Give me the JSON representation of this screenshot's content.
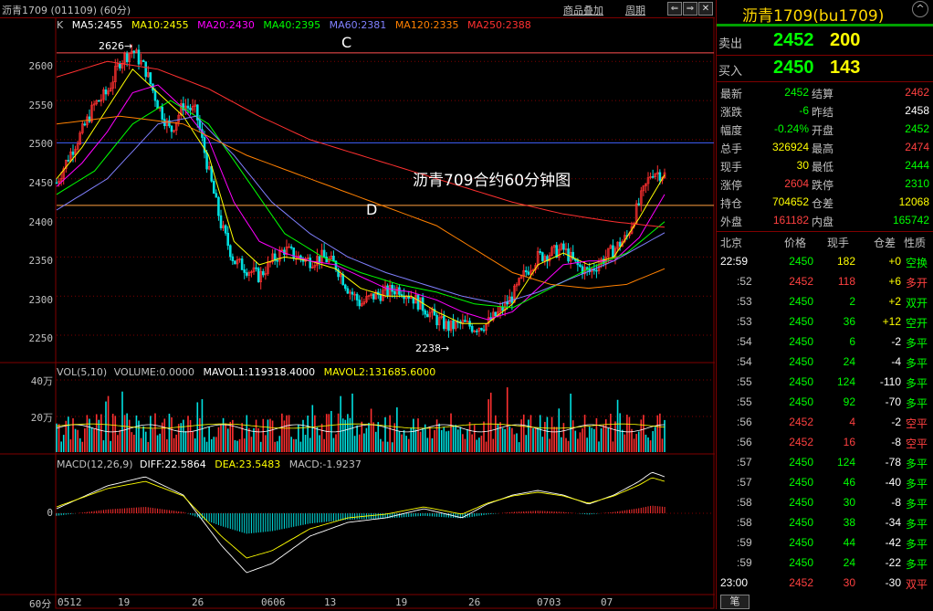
{
  "window_title": "沥青1709 (011109) (60分)",
  "toolbar": {
    "link1": "商品叠加",
    "link2": "周期",
    "btn_left": "⇐",
    "btn_right": "⇒",
    "btn_max": "□",
    "btn_close": "✕"
  },
  "chart_data": [
    {
      "type": "candlestick",
      "panel": "main",
      "prefix": "K",
      "title": "沥青709合约60分钟图",
      "ma_legend": [
        {
          "label": "MA5:2455",
          "color": "#ffffff"
        },
        {
          "label": "MA10:2455",
          "color": "#ffff00"
        },
        {
          "label": "MA20:2430",
          "color": "#ff00ff"
        },
        {
          "label": "MA40:2395",
          "color": "#00ff00"
        },
        {
          "label": "MA60:2381",
          "color": "#8080ff"
        },
        {
          "label": "MA120:2335",
          "color": "#ff8000"
        },
        {
          "label": "MA250:2388",
          "color": "#ff3030"
        }
      ],
      "y_ticks": [
        "2600",
        "2550",
        "2500",
        "2450",
        "2400",
        "2350",
        "2300",
        "2250"
      ],
      "ylim": [
        2215,
        2640
      ],
      "annotations": {
        "high": "2626",
        "low": "2238",
        "label_c": "C",
        "label_d": "D",
        "level_c": 2611,
        "level_blue": 2496,
        "level_d": 2416
      },
      "x_labels": [
        "0512",
        "19",
        "26",
        "0606",
        "13",
        "19",
        "26",
        "0703",
        "07"
      ],
      "close_path": [
        [
          0,
          2445
        ],
        [
          2,
          2480
        ],
        [
          4,
          2510
        ],
        [
          6,
          2545
        ],
        [
          8,
          2560
        ],
        [
          10,
          2600
        ],
        [
          12,
          2615
        ],
        [
          14,
          2590
        ],
        [
          16,
          2545
        ],
        [
          18,
          2510
        ],
        [
          20,
          2545
        ],
        [
          22,
          2535
        ],
        [
          24,
          2460
        ],
        [
          26,
          2390
        ],
        [
          28,
          2345
        ],
        [
          30,
          2335
        ],
        [
          32,
          2325
        ],
        [
          34,
          2345
        ],
        [
          36,
          2360
        ],
        [
          38,
          2350
        ],
        [
          40,
          2345
        ],
        [
          42,
          2350
        ],
        [
          44,
          2340
        ],
        [
          46,
          2310
        ],
        [
          48,
          2290
        ],
        [
          50,
          2300
        ],
        [
          52,
          2305
        ],
        [
          54,
          2310
        ],
        [
          56,
          2300
        ],
        [
          58,
          2285
        ],
        [
          60,
          2270
        ],
        [
          62,
          2260
        ],
        [
          64,
          2265
        ],
        [
          66,
          2260
        ],
        [
          68,
          2265
        ],
        [
          70,
          2280
        ],
        [
          72,
          2300
        ],
        [
          74,
          2330
        ],
        [
          76,
          2350
        ],
        [
          78,
          2355
        ],
        [
          80,
          2360
        ],
        [
          82,
          2340
        ],
        [
          84,
          2330
        ],
        [
          86,
          2345
        ],
        [
          88,
          2360
        ],
        [
          90,
          2375
        ],
        [
          92,
          2420
        ],
        [
          94,
          2460
        ],
        [
          96,
          2455
        ]
      ],
      "ma_paths": [
        {
          "name": "MA10",
          "color": "#ffff00",
          "points": [
            [
              0,
              2450
            ],
            [
              4,
              2490
            ],
            [
              8,
              2540
            ],
            [
              12,
              2590
            ],
            [
              16,
              2560
            ],
            [
              20,
              2530
            ],
            [
              24,
              2480
            ],
            [
              28,
              2370
            ],
            [
              32,
              2340
            ],
            [
              36,
              2350
            ],
            [
              40,
              2345
            ],
            [
              44,
              2335
            ],
            [
              48,
              2310
            ],
            [
              52,
              2300
            ],
            [
              56,
              2300
            ],
            [
              60,
              2280
            ],
            [
              64,
              2265
            ],
            [
              68,
              2265
            ],
            [
              72,
              2290
            ],
            [
              76,
              2340
            ],
            [
              80,
              2355
            ],
            [
              84,
              2340
            ],
            [
              88,
              2350
            ],
            [
              92,
              2400
            ],
            [
              96,
              2455
            ]
          ]
        },
        {
          "name": "MA20",
          "color": "#ff00ff",
          "points": [
            [
              0,
              2440
            ],
            [
              4,
              2470
            ],
            [
              8,
              2510
            ],
            [
              12,
              2560
            ],
            [
              16,
              2570
            ],
            [
              20,
              2540
            ],
            [
              24,
              2500
            ],
            [
              28,
              2420
            ],
            [
              32,
              2370
            ],
            [
              36,
              2355
            ],
            [
              40,
              2345
            ],
            [
              44,
              2340
            ],
            [
              48,
              2325
            ],
            [
              52,
              2310
            ],
            [
              56,
              2305
            ],
            [
              60,
              2295
            ],
            [
              64,
              2280
            ],
            [
              68,
              2270
            ],
            [
              72,
              2280
            ],
            [
              76,
              2310
            ],
            [
              80,
              2340
            ],
            [
              84,
              2345
            ],
            [
              88,
              2345
            ],
            [
              92,
              2375
            ],
            [
              96,
              2430
            ]
          ]
        },
        {
          "name": "MA40",
          "color": "#00ff00",
          "points": [
            [
              0,
              2430
            ],
            [
              6,
              2460
            ],
            [
              12,
              2520
            ],
            [
              18,
              2550
            ],
            [
              24,
              2520
            ],
            [
              30,
              2450
            ],
            [
              36,
              2380
            ],
            [
              42,
              2350
            ],
            [
              48,
              2330
            ],
            [
              54,
              2315
            ],
            [
              60,
              2305
            ],
            [
              66,
              2290
            ],
            [
              72,
              2285
            ],
            [
              78,
              2310
            ],
            [
              84,
              2335
            ],
            [
              90,
              2355
            ],
            [
              96,
              2395
            ]
          ]
        },
        {
          "name": "MA60",
          "color": "#8080ff",
          "points": [
            [
              0,
              2410
            ],
            [
              8,
              2450
            ],
            [
              16,
              2520
            ],
            [
              22,
              2530
            ],
            [
              28,
              2480
            ],
            [
              34,
              2420
            ],
            [
              40,
              2380
            ],
            [
              46,
              2350
            ],
            [
              52,
              2330
            ],
            [
              58,
              2315
            ],
            [
              64,
              2300
            ],
            [
              70,
              2290
            ],
            [
              76,
              2305
            ],
            [
              82,
              2325
            ],
            [
              88,
              2345
            ],
            [
              96,
              2381
            ]
          ]
        },
        {
          "name": "MA120",
          "color": "#ff8000",
          "points": [
            [
              0,
              2520
            ],
            [
              10,
              2530
            ],
            [
              20,
              2520
            ],
            [
              30,
              2480
            ],
            [
              40,
              2450
            ],
            [
              50,
              2420
            ],
            [
              60,
              2390
            ],
            [
              66,
              2360
            ],
            [
              72,
              2330
            ],
            [
              78,
              2315
            ],
            [
              84,
              2310
            ],
            [
              90,
              2315
            ],
            [
              96,
              2335
            ]
          ]
        },
        {
          "name": "MA250",
          "color": "#ff3030",
          "points": [
            [
              0,
              2580
            ],
            [
              8,
              2600
            ],
            [
              16,
              2590
            ],
            [
              24,
              2565
            ],
            [
              32,
              2530
            ],
            [
              40,
              2500
            ],
            [
              48,
              2480
            ],
            [
              56,
              2460
            ],
            [
              64,
              2440
            ],
            [
              72,
              2420
            ],
            [
              80,
              2405
            ],
            [
              88,
              2395
            ],
            [
              96,
              2388
            ]
          ]
        }
      ]
    },
    {
      "type": "bar",
      "panel": "volume",
      "legend": "VOL(5,10)",
      "items": [
        {
          "label": "VOLUME:0.0000",
          "color": "#c0c0c0"
        },
        {
          "label": "MAVOL1:119318.4000",
          "color": "#ffffff"
        },
        {
          "label": "MAVOL2:131685.6000",
          "color": "#ffff00"
        }
      ],
      "y_ticks": [
        "40万",
        "20万"
      ]
    },
    {
      "type": "bar",
      "panel": "macd",
      "legend": "MACD(12,26,9)",
      "items": [
        {
          "label": "DIFF:22.5864",
          "color": "#ffffff"
        },
        {
          "label": "DEA:23.5483",
          "color": "#ffff00"
        },
        {
          "label": "MACD:-1.9237",
          "color": "#ff00ff"
        }
      ],
      "y_ticks": [
        "0"
      ]
    }
  ],
  "bottom": {
    "period": "60分",
    "tab": "笔"
  },
  "right": {
    "name": "沥青1709(bu1709)",
    "ask_label": "卖出",
    "ask_price": "2452",
    "ask_vol": "200",
    "bid_label": "买入",
    "bid_price": "2450",
    "bid_vol": "143",
    "quote_rows": [
      {
        "l1": "最新",
        "v1": "2452",
        "c1": "#00ff00",
        "l2": "结算",
        "v2": "2462",
        "c2": "#ff4040"
      },
      {
        "l1": "涨跌",
        "v1": "-6",
        "c1": "#00ff00",
        "l2": "昨结",
        "v2": "2458",
        "c2": "#ffffff"
      },
      {
        "l1": "幅度",
        "v1": "-0.24%",
        "c1": "#00ff00",
        "l2": "开盘",
        "v2": "2452",
        "c2": "#00ff00"
      },
      {
        "l1": "总手",
        "v1": "326924",
        "c1": "#ffff00",
        "l2": "最高",
        "v2": "2474",
        "c2": "#ff4040"
      },
      {
        "l1": "现手",
        "v1": "30",
        "c1": "#ffff00",
        "l2": "最低",
        "v2": "2444",
        "c2": "#00ff00"
      },
      {
        "l1": "涨停",
        "v1": "2604",
        "c1": "#ff4040",
        "l2": "跌停",
        "v2": "2310",
        "c2": "#00ff00"
      },
      {
        "l1": "持仓",
        "v1": "704652",
        "c1": "#ffff00",
        "l2": "仓差",
        "v2": "12068",
        "c2": "#ffff00"
      },
      {
        "l1": "外盘",
        "v1": "161182",
        "c1": "#ff4040",
        "l2": "内盘",
        "v2": "165742",
        "c2": "#00ff00"
      }
    ],
    "tick_headers": [
      "北京",
      "价格",
      "现手",
      "仓差",
      "性质"
    ],
    "ticks": [
      {
        "time": "22:59",
        "price": "2450",
        "pc": "#00ff00",
        "vol": "182",
        "vc": "#ffff00",
        "oi": "+0",
        "oc": "#ffff00",
        "nature": "空换",
        "nc": "#00ff00"
      },
      {
        "time": ":52",
        "price": "2452",
        "pc": "#ff4040",
        "vol": "118",
        "vc": "#ff4040",
        "oi": "+6",
        "oc": "#ffff00",
        "nature": "多开",
        "nc": "#ff4040"
      },
      {
        "time": ":53",
        "price": "2450",
        "pc": "#00ff00",
        "vol": "2",
        "vc": "#00ff00",
        "oi": "+2",
        "oc": "#ffff00",
        "nature": "双开",
        "nc": "#00ff00"
      },
      {
        "time": ":53",
        "price": "2450",
        "pc": "#00ff00",
        "vol": "36",
        "vc": "#00ff00",
        "oi": "+12",
        "oc": "#ffff00",
        "nature": "空开",
        "nc": "#00ff00"
      },
      {
        "time": ":54",
        "price": "2450",
        "pc": "#00ff00",
        "vol": "6",
        "vc": "#00ff00",
        "oi": "-2",
        "oc": "#ffffff",
        "nature": "多平",
        "nc": "#00ff00"
      },
      {
        "time": ":54",
        "price": "2450",
        "pc": "#00ff00",
        "vol": "24",
        "vc": "#00ff00",
        "oi": "-4",
        "oc": "#ffffff",
        "nature": "多平",
        "nc": "#00ff00"
      },
      {
        "time": ":55",
        "price": "2450",
        "pc": "#00ff00",
        "vol": "124",
        "vc": "#00ff00",
        "oi": "-110",
        "oc": "#ffffff",
        "nature": "多平",
        "nc": "#00ff00"
      },
      {
        "time": ":55",
        "price": "2450",
        "pc": "#00ff00",
        "vol": "92",
        "vc": "#00ff00",
        "oi": "-70",
        "oc": "#ffffff",
        "nature": "多平",
        "nc": "#00ff00"
      },
      {
        "time": ":56",
        "price": "2452",
        "pc": "#ff4040",
        "vol": "4",
        "vc": "#ff4040",
        "oi": "-2",
        "oc": "#ffffff",
        "nature": "空平",
        "nc": "#ff4040"
      },
      {
        "time": ":56",
        "price": "2452",
        "pc": "#ff4040",
        "vol": "16",
        "vc": "#ff4040",
        "oi": "-8",
        "oc": "#ffffff",
        "nature": "空平",
        "nc": "#ff4040"
      },
      {
        "time": ":57",
        "price": "2450",
        "pc": "#00ff00",
        "vol": "124",
        "vc": "#00ff00",
        "oi": "-78",
        "oc": "#ffffff",
        "nature": "多平",
        "nc": "#00ff00"
      },
      {
        "time": ":57",
        "price": "2450",
        "pc": "#00ff00",
        "vol": "46",
        "vc": "#00ff00",
        "oi": "-40",
        "oc": "#ffffff",
        "nature": "多平",
        "nc": "#00ff00"
      },
      {
        "time": ":58",
        "price": "2450",
        "pc": "#00ff00",
        "vol": "30",
        "vc": "#00ff00",
        "oi": "-8",
        "oc": "#ffffff",
        "nature": "多平",
        "nc": "#00ff00"
      },
      {
        "time": ":58",
        "price": "2450",
        "pc": "#00ff00",
        "vol": "38",
        "vc": "#00ff00",
        "oi": "-34",
        "oc": "#ffffff",
        "nature": "多平",
        "nc": "#00ff00"
      },
      {
        "time": ":59",
        "price": "2450",
        "pc": "#00ff00",
        "vol": "44",
        "vc": "#00ff00",
        "oi": "-42",
        "oc": "#ffffff",
        "nature": "多平",
        "nc": "#00ff00"
      },
      {
        "time": ":59",
        "price": "2450",
        "pc": "#00ff00",
        "vol": "24",
        "vc": "#00ff00",
        "oi": "-22",
        "oc": "#ffffff",
        "nature": "多平",
        "nc": "#00ff00"
      },
      {
        "time": "23:00",
        "price": "2452",
        "pc": "#ff4040",
        "vol": "30",
        "vc": "#ff4040",
        "oi": "-30",
        "oc": "#ffffff",
        "nature": "双平",
        "nc": "#ff4040"
      }
    ]
  }
}
